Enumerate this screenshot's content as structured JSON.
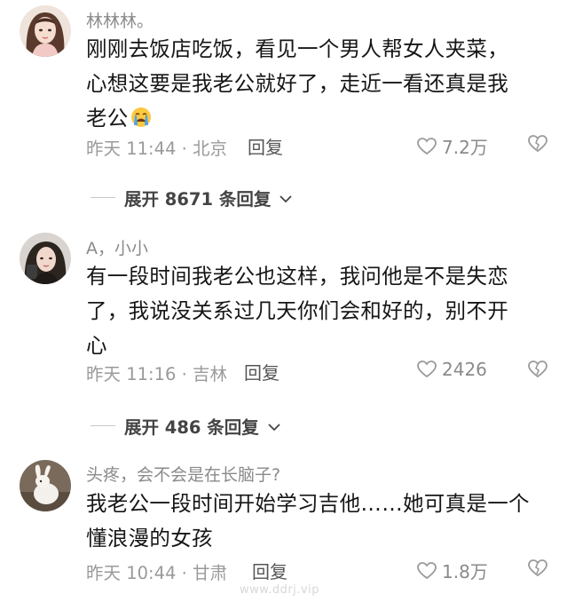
{
  "comments": [
    {
      "username": "林林林。",
      "lines": [
        "刚刚去饭店吃饭，看见一个男人帮女人夹菜，",
        "心想这要是我老公就好了，走近一看还真是我",
        "老公"
      ],
      "emoji": "crying-face",
      "time_location": "昨天 11:44 · 北京",
      "reply_label": "回复",
      "likes": "7.2万",
      "expand_label": "展开 8671 条回复"
    },
    {
      "username": "A，小小",
      "lines": [
        "有一段时间我老公也这样，我问他是不是失恋",
        "了，我说没关系过几天你们会和好的，别不开",
        "心"
      ],
      "time_location": "昨天 11:16 · 吉林",
      "reply_label": "回复",
      "likes": "2426",
      "expand_label": "展开 486 条回复"
    },
    {
      "username": "头疼，会不会是在长脑子?",
      "lines": [
        "我老公一段时间开始学习吉他……她可真是一个",
        "懂浪漫的女孩"
      ],
      "time_location": "昨天 10:44 · 甘肃",
      "reply_label": "回复",
      "likes": "1.8万"
    }
  ],
  "watermark": "www.ddrj.vip",
  "icons": {
    "like": "heart-outline-icon",
    "dislike": "broken-heart-icon",
    "expand": "chevron-down-icon"
  },
  "colors": {
    "text": "#161616",
    "muted": "#9a9a9a",
    "username": "#8a8a8a"
  }
}
